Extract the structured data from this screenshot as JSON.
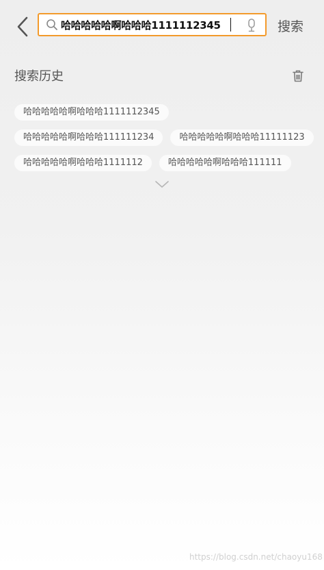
{
  "header": {
    "back_icon": "chevron-left-icon",
    "search_icon": "search-icon",
    "search_value": "哈哈哈哈哈啊哈哈哈1111112345",
    "mic_icon": "microphone-icon",
    "search_button_label": "搜索",
    "accent_color": "#f39a2b"
  },
  "history": {
    "title": "搜索历史",
    "clear_icon": "trash-icon",
    "rows": [
      [
        "哈哈哈哈哈啊哈哈哈1111112345"
      ],
      [
        "哈哈哈哈哈啊哈哈哈111111234",
        "哈哈哈哈哈啊哈哈哈11111123"
      ],
      [
        "哈哈哈哈哈啊哈哈哈1111112",
        "哈哈哈哈哈啊哈哈哈111111"
      ]
    ],
    "expand_icon": "chevron-down-icon"
  },
  "watermark": "https://blog.csdn.net/chaoyu168"
}
